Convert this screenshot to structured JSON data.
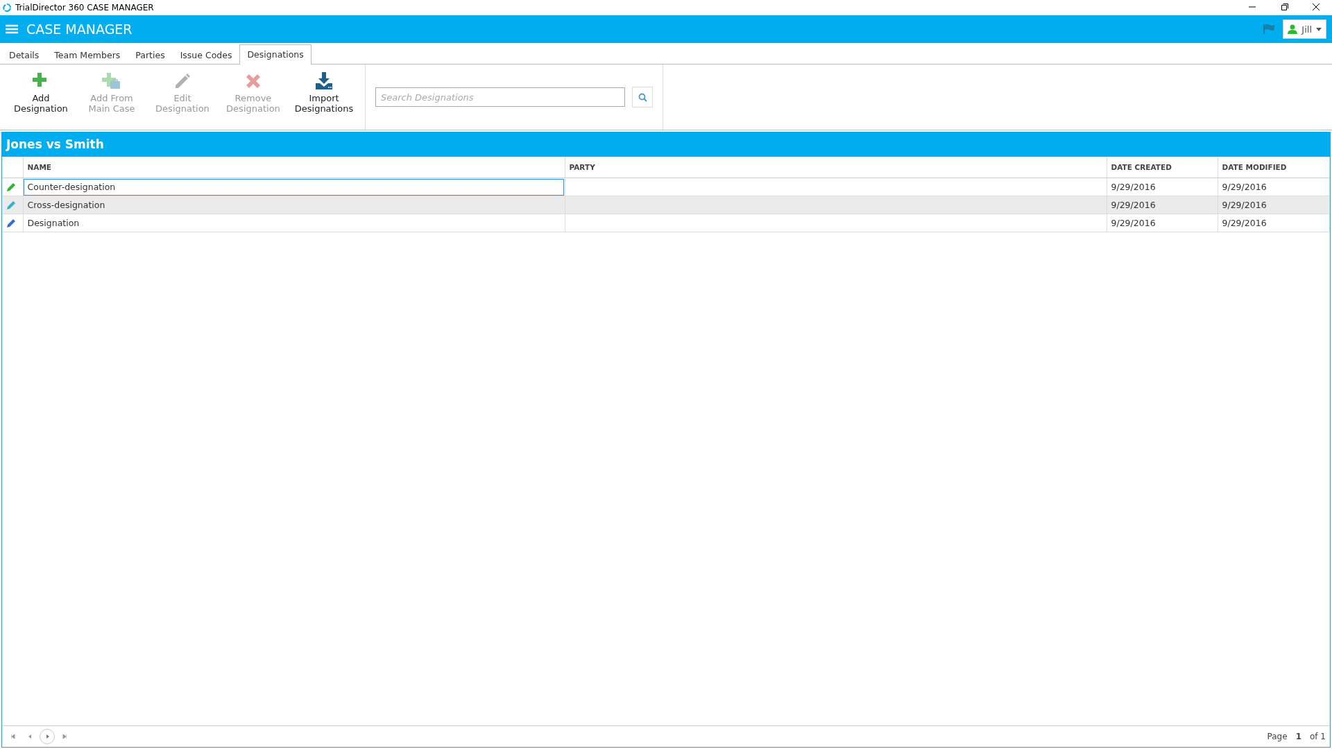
{
  "window": {
    "title": "TrialDirector 360 CASE MANAGER"
  },
  "header": {
    "title": "CASE MANAGER",
    "user": "Jill"
  },
  "tabs": [
    {
      "label": "Details",
      "selected": false
    },
    {
      "label": "Team Members",
      "selected": false
    },
    {
      "label": "Parties",
      "selected": false
    },
    {
      "label": "Issue Codes",
      "selected": false
    },
    {
      "label": "Designations",
      "selected": true
    }
  ],
  "toolbar": [
    {
      "kind": "add",
      "label": "Add Designation",
      "disabled": false
    },
    {
      "kind": "add-from",
      "label": "Add From Main Case",
      "disabled": true
    },
    {
      "kind": "edit",
      "label": "Edit Designation",
      "disabled": true
    },
    {
      "kind": "remove",
      "label": "Remove Designation",
      "disabled": true
    },
    {
      "kind": "import",
      "label": "Import Designations",
      "disabled": false
    }
  ],
  "search": {
    "placeholder": "Search Designations"
  },
  "panel": {
    "title": "Jones vs Smith"
  },
  "table": {
    "columns": [
      "NAME",
      "PARTY",
      "DATE CREATED",
      "DATE MODIFIED"
    ],
    "rows": [
      {
        "color": "#2db82d",
        "selected": false,
        "focused": true,
        "cells": [
          "Counter-designation",
          "",
          "9/29/2016",
          "9/29/2016"
        ]
      },
      {
        "color": "#3bb0c9",
        "selected": true,
        "focused": false,
        "cells": [
          "Cross-designation",
          "",
          "9/29/2016",
          "9/29/2016"
        ]
      },
      {
        "color": "#3a6fc4",
        "selected": false,
        "focused": false,
        "cells": [
          "Designation",
          "",
          "9/29/2016",
          "9/29/2016"
        ]
      }
    ]
  },
  "pager": {
    "label": "Page",
    "page": "1",
    "total": "of 1"
  }
}
